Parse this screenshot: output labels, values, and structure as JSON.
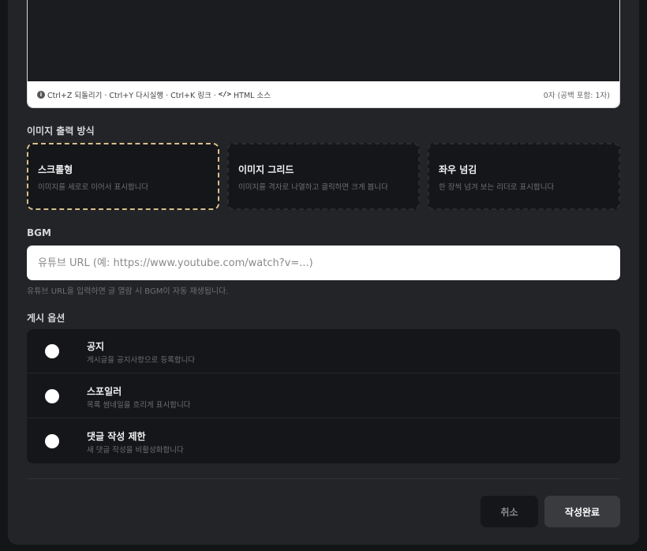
{
  "editor": {
    "hint_parts": [
      "Ctrl+Z 되돌리기 · Ctrl+Y 다시실행 · Ctrl+K 링크 ·",
      "HTML 소스"
    ],
    "code_symbol": "</>",
    "counter": "0자 (공백 포함: 1자)"
  },
  "display_mode": {
    "label": "이미지 출력 방식",
    "selected": "스크롤형",
    "options": [
      {
        "title": "스크롤형",
        "desc": "이미지를 세로로 이어서 표시합니다"
      },
      {
        "title": "이미지 그리드",
        "desc": "이미지를 격자로 나열하고 클릭하면 크게 봅니다"
      },
      {
        "title": "좌우 넘김",
        "desc": "한 장씩 넘겨 보는 리더로 표시합니다"
      }
    ]
  },
  "bgm": {
    "label": "BGM",
    "placeholder": "유튜브 URL (예: https://www.youtube.com/watch?v=...)",
    "value": "",
    "help": "유튜브 URL을 입력하면 글 열람 시 BGM이 자동 재생됩니다."
  },
  "post_options": {
    "label": "게시 옵션",
    "items": [
      {
        "title": "공지",
        "desc": "게시글을 공지사항으로 등록합니다"
      },
      {
        "title": "스포일러",
        "desc": "목록 썸네일을 흐리게 표시합니다"
      },
      {
        "title": "댓글 작성 제한",
        "desc": "새 댓글 작성을 비활성화합니다"
      }
    ]
  },
  "actions": {
    "cancel": "취소",
    "submit": "작성완료"
  }
}
